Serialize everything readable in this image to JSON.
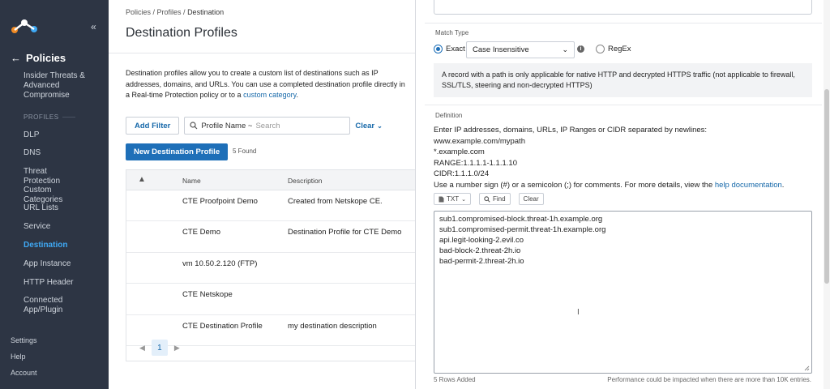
{
  "sidebar": {
    "section_title": "Policies",
    "items": [
      {
        "label": "Insider Threats & Advanced Compromise"
      },
      {
        "label": "PROFILES"
      },
      {
        "label": "DLP"
      },
      {
        "label": "DNS"
      },
      {
        "label": "Threat Protection"
      },
      {
        "label": "Custom Categories"
      },
      {
        "label": "URL Lists"
      },
      {
        "label": "Service"
      },
      {
        "label": "Destination"
      },
      {
        "label": "App Instance"
      },
      {
        "label": "HTTP Header"
      },
      {
        "label": "Connected App/Plugin"
      }
    ],
    "bottom": [
      {
        "label": "Settings"
      },
      {
        "label": "Help"
      },
      {
        "label": "Account"
      }
    ]
  },
  "main": {
    "breadcrumb": {
      "a": "Policies",
      "b": "Profiles",
      "c": "Destination",
      "sep": " / "
    },
    "title": "Destination Profiles",
    "description_prefix": "Destination profiles allow you to create a custom list of destinations such as IP addresses, domains, and URLs. You can use a completed destination profile directly in a Real-time Protection policy or to a ",
    "description_link": "custom category",
    "description_suffix": ".",
    "add_filter": "Add Filter",
    "search_key": "Profile Name ~",
    "search_placeholder": "Search",
    "clear": "Clear",
    "new_button": "New Destination Profile",
    "found": "5 Found",
    "table": {
      "headers": [
        "Name",
        "Description"
      ],
      "rows": [
        {
          "name": "CTE Proofpoint Demo",
          "description": "Created from Netskope CE."
        },
        {
          "name": "CTE Demo",
          "description": "Destination Profile for CTE Demo"
        },
        {
          "name": "vm 10.50.2.120 (FTP)",
          "description": ""
        },
        {
          "name": "CTE Netskope",
          "description": ""
        },
        {
          "name": "CTE Destination Profile",
          "description": "my destination description"
        }
      ]
    },
    "pager": {
      "current": "1"
    }
  },
  "panel": {
    "match_type_label": "Match Type",
    "exact": "Exact",
    "case_option": "Case Insensitive",
    "regex": "RegEx",
    "note": "A record with a path is only applicable for native HTTP and decrypted HTTPS traffic (not applicable to firewall, SSL/TLS, steering and non-decrypted HTTPS)",
    "definition_label": "Definition",
    "def_lines": [
      "Enter IP addresses, domains, URLs, IP Ranges or CIDR separated by newlines:",
      "www.example.com/mypath",
      "*.example.com",
      "RANGE:1.1.1.1-1.1.1.10",
      "CIDR:1.1.1.0/24"
    ],
    "def_comment_prefix": "Use a number sign (#) or a semicolon (;) for comments. For more details, view the ",
    "def_comment_link": "help documentation",
    "def_comment_suffix": ".",
    "tools": {
      "txt": "TXT",
      "find": "Find",
      "clear": "Clear"
    },
    "entries": [
      "sub1.compromised-block.threat-1h.example.org",
      "sub1.compromised-permit.threat-1h.example.org",
      "api.legit-looking-2.evil.co",
      "bad-block-2.threat-2h.io",
      "bad-permit-2.threat-2h.io"
    ],
    "rows_added": "5 Rows Added",
    "perf_note": "Performance could be impacted when there are more than 10K entries."
  },
  "colors": {
    "sidebar_bg": "#2d3544",
    "accent": "#1e6fb8",
    "link": "#1769aa"
  }
}
